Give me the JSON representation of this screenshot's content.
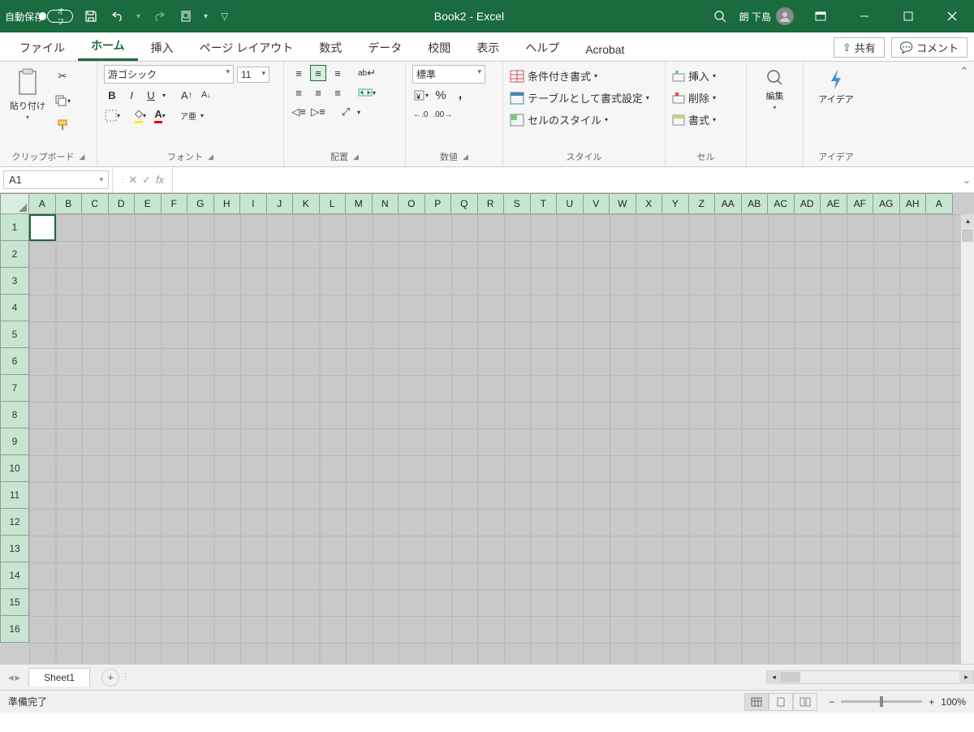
{
  "titlebar": {
    "autosave_label": "自動保存",
    "autosave_toggle": "オフ",
    "doc_title": "Book2 - Excel",
    "user_name": "朗 下島"
  },
  "tabs": {
    "file": "ファイル",
    "home": "ホーム",
    "insert": "挿入",
    "page_layout": "ページ レイアウト",
    "formulas": "数式",
    "data": "データ",
    "review": "校閲",
    "view": "表示",
    "help": "ヘルプ",
    "acrobat": "Acrobat",
    "share": "共有",
    "comments": "コメント"
  },
  "ribbon": {
    "clipboard": {
      "paste": "貼り付け",
      "label": "クリップボード"
    },
    "font": {
      "name": "游ゴシック",
      "size": "11",
      "label": "フォント",
      "ruby": "ア亜"
    },
    "alignment": {
      "label": "配置",
      "wrap": "ab"
    },
    "number": {
      "format": "標準",
      "label": "数値",
      "dec1": ".0",
      "dec2": ".00"
    },
    "styles": {
      "conditional": "条件付き書式",
      "table": "テーブルとして書式設定",
      "cell_styles": "セルのスタイル",
      "label": "スタイル"
    },
    "cells": {
      "insert": "挿入",
      "delete": "削除",
      "format": "書式",
      "label": "セル"
    },
    "editing": {
      "label": "編集"
    },
    "ideas": {
      "btn": "アイデア",
      "label": "アイデア"
    }
  },
  "formula_bar": {
    "cell_ref": "A1",
    "fx": "fx",
    "value": ""
  },
  "grid": {
    "columns": [
      "A",
      "B",
      "C",
      "D",
      "E",
      "F",
      "G",
      "H",
      "I",
      "J",
      "K",
      "L",
      "M",
      "N",
      "O",
      "P",
      "Q",
      "R",
      "S",
      "T",
      "U",
      "V",
      "W",
      "X",
      "Y",
      "Z",
      "AA",
      "AB",
      "AC",
      "AD",
      "AE",
      "AF",
      "AG",
      "AH",
      "A"
    ],
    "rows": [
      "1",
      "2",
      "3",
      "4",
      "5",
      "6",
      "7",
      "8",
      "9",
      "10",
      "11",
      "12",
      "13",
      "14",
      "15",
      "16"
    ]
  },
  "sheetbar": {
    "sheet1": "Sheet1"
  },
  "statusbar": {
    "ready": "準備完了",
    "zoom": "100%"
  }
}
